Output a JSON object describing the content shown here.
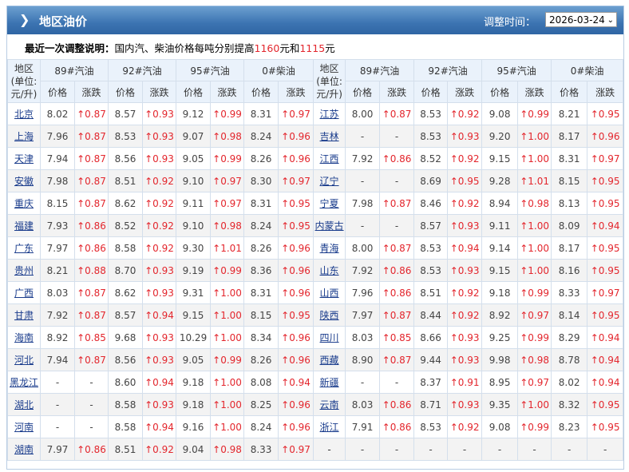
{
  "header": {
    "title": "地区油价",
    "adjust_time_label": "调整时间：",
    "date_selected": "2026-03-24"
  },
  "notice": {
    "label": "最近一次调整说明：",
    "text_before": "国内汽、柴油价格每吨分别提高",
    "gasoline_increase": "1160",
    "text_mid": "元和",
    "diesel_increase": "1115",
    "text_after": "元"
  },
  "columns": {
    "region_left": "地区(单位:元/升)",
    "region_right": "地区(单位:元/升)",
    "fuels": [
      "89#汽油",
      "92#汽油",
      "95#汽油",
      "0#柴油"
    ],
    "price": "价格",
    "change": "涨跌"
  },
  "colors": {
    "title_bar": "#3c74b2",
    "rise": "#e3262d",
    "link": "#1a3c8c"
  },
  "left_rows": [
    {
      "region": "北京",
      "v": [
        "8.02",
        "↑0.87",
        "8.57",
        "↑0.93",
        "9.12",
        "↑0.99",
        "8.31",
        "↑0.97"
      ]
    },
    {
      "region": "上海",
      "v": [
        "7.96",
        "↑0.87",
        "8.53",
        "↑0.93",
        "9.07",
        "↑0.98",
        "8.24",
        "↑0.96"
      ]
    },
    {
      "region": "天津",
      "v": [
        "7.94",
        "↑0.87",
        "8.56",
        "↑0.93",
        "9.05",
        "↑0.99",
        "8.26",
        "↑0.96"
      ]
    },
    {
      "region": "安徽",
      "v": [
        "7.98",
        "↑0.87",
        "8.51",
        "↑0.92",
        "9.10",
        "↑0.97",
        "8.30",
        "↑0.97"
      ]
    },
    {
      "region": "重庆",
      "v": [
        "8.15",
        "↑0.87",
        "8.62",
        "↑0.92",
        "9.11",
        "↑0.97",
        "8.31",
        "↑0.95"
      ]
    },
    {
      "region": "福建",
      "v": [
        "7.93",
        "↑0.86",
        "8.52",
        "↑0.92",
        "9.10",
        "↑0.98",
        "8.24",
        "↑0.95"
      ]
    },
    {
      "region": "广东",
      "v": [
        "7.97",
        "↑0.86",
        "8.58",
        "↑0.92",
        "9.30",
        "↑1.01",
        "8.26",
        "↑0.96"
      ]
    },
    {
      "region": "贵州",
      "v": [
        "8.21",
        "↑0.88",
        "8.70",
        "↑0.93",
        "9.19",
        "↑0.99",
        "8.36",
        "↑0.96"
      ]
    },
    {
      "region": "广西",
      "v": [
        "8.03",
        "↑0.87",
        "8.62",
        "↑0.93",
        "9.31",
        "↑1.00",
        "8.31",
        "↑0.96"
      ]
    },
    {
      "region": "甘肃",
      "v": [
        "7.92",
        "↑0.87",
        "8.57",
        "↑0.94",
        "9.15",
        "↑1.00",
        "8.15",
        "↑0.95"
      ]
    },
    {
      "region": "海南",
      "v": [
        "8.92",
        "↑0.85",
        "9.68",
        "↑0.93",
        "10.29",
        "↑1.00",
        "8.34",
        "↑0.96"
      ]
    },
    {
      "region": "河北",
      "v": [
        "7.94",
        "↑0.87",
        "8.56",
        "↑0.93",
        "9.05",
        "↑0.99",
        "8.26",
        "↑0.96"
      ]
    },
    {
      "region": "黑龙江",
      "v": [
        "-",
        "-",
        "8.60",
        "↑0.94",
        "9.18",
        "↑1.00",
        "8.08",
        "↑0.94"
      ]
    },
    {
      "region": "湖北",
      "v": [
        "-",
        "-",
        "8.58",
        "↑0.93",
        "9.18",
        "↑1.00",
        "8.25",
        "↑0.96"
      ]
    },
    {
      "region": "河南",
      "v": [
        "-",
        "-",
        "8.58",
        "↑0.94",
        "9.16",
        "↑1.00",
        "8.24",
        "↑0.96"
      ]
    },
    {
      "region": "湖南",
      "v": [
        "7.97",
        "↑0.86",
        "8.51",
        "↑0.92",
        "9.04",
        "↑0.98",
        "8.33",
        "↑0.97"
      ]
    }
  ],
  "right_rows": [
    {
      "region": "江苏",
      "v": [
        "8.00",
        "↑0.87",
        "8.53",
        "↑0.92",
        "9.08",
        "↑0.99",
        "8.21",
        "↑0.95"
      ]
    },
    {
      "region": "吉林",
      "v": [
        "-",
        "-",
        "8.53",
        "↑0.93",
        "9.20",
        "↑1.00",
        "8.17",
        "↑0.96"
      ]
    },
    {
      "region": "江西",
      "v": [
        "7.92",
        "↑0.86",
        "8.52",
        "↑0.92",
        "9.15",
        "↑1.00",
        "8.31",
        "↑0.97"
      ]
    },
    {
      "region": "辽宁",
      "v": [
        "-",
        "-",
        "8.69",
        "↑0.95",
        "9.28",
        "↑1.01",
        "8.15",
        "↑0.95"
      ]
    },
    {
      "region": "宁夏",
      "v": [
        "7.98",
        "↑0.87",
        "8.46",
        "↑0.92",
        "8.94",
        "↑0.98",
        "8.13",
        "↑0.95"
      ]
    },
    {
      "region": "内蒙古",
      "v": [
        "-",
        "-",
        "8.57",
        "↑0.93",
        "9.11",
        "↑1.00",
        "8.09",
        "↑0.94"
      ]
    },
    {
      "region": "青海",
      "v": [
        "8.00",
        "↑0.87",
        "8.53",
        "↑0.94",
        "9.14",
        "↑1.00",
        "8.17",
        "↑0.95"
      ]
    },
    {
      "region": "山东",
      "v": [
        "7.92",
        "↑0.86",
        "8.53",
        "↑0.93",
        "9.15",
        "↑1.00",
        "8.16",
        "↑0.95"
      ]
    },
    {
      "region": "山西",
      "v": [
        "7.96",
        "↑0.86",
        "8.51",
        "↑0.92",
        "9.18",
        "↑0.99",
        "8.33",
        "↑0.97"
      ]
    },
    {
      "region": "陕西",
      "v": [
        "7.97",
        "↑0.87",
        "8.44",
        "↑0.92",
        "8.92",
        "↑0.97",
        "8.14",
        "↑0.95"
      ]
    },
    {
      "region": "四川",
      "v": [
        "8.03",
        "↑0.85",
        "8.66",
        "↑0.93",
        "9.25",
        "↑0.99",
        "8.29",
        "↑0.94"
      ]
    },
    {
      "region": "西藏",
      "v": [
        "8.90",
        "↑0.87",
        "9.44",
        "↑0.93",
        "9.98",
        "↑0.98",
        "8.78",
        "↑0.94"
      ]
    },
    {
      "region": "新疆",
      "v": [
        "-",
        "-",
        "8.37",
        "↑0.91",
        "8.95",
        "↑0.97",
        "8.02",
        "↑0.94"
      ]
    },
    {
      "region": "云南",
      "v": [
        "8.03",
        "↑0.86",
        "8.71",
        "↑0.93",
        "9.35",
        "↑1.00",
        "8.32",
        "↑0.95"
      ]
    },
    {
      "region": "浙江",
      "v": [
        "7.91",
        "↑0.86",
        "8.53",
        "↑0.92",
        "9.08",
        "↑0.99",
        "8.23",
        "↑0.95"
      ]
    },
    {
      "region": "-",
      "v": [
        "-",
        "-",
        "-",
        "-",
        "-",
        "-",
        "-",
        "-"
      ]
    }
  ]
}
